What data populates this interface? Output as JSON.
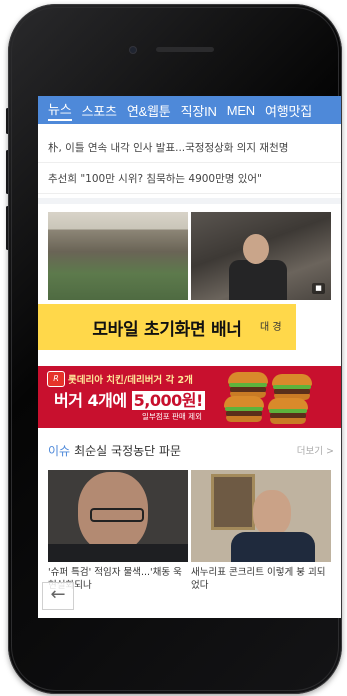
{
  "nav": {
    "tabs": [
      {
        "label": "뉴스",
        "active": true
      },
      {
        "label": "스포츠",
        "active": false
      },
      {
        "label": "연&웹툰",
        "active": false
      },
      {
        "label": "직장IN",
        "active": false
      },
      {
        "label": "MEN",
        "active": false
      },
      {
        "label": "여행맛집",
        "active": false
      }
    ],
    "color": "#4e89d9"
  },
  "headlines": [
    "朴, 이틀 연속 내각 인사 발표...국정정상화 의지 재천명",
    "추선희 \"100만 시위? 침묵하는 4900만명 있어\""
  ],
  "news_cards": {
    "second_caption": "대 경"
  },
  "overlay_banner": {
    "text": "모바일 초기화면 배너",
    "color": "#ffd84a"
  },
  "ad_banner": {
    "logo": "R",
    "top_text": "롯데리아 치킨/데리버거 각 2개",
    "main_prefix": "버거 4개에",
    "main_price": "5,000원!",
    "note": "일부점포 판매 제외",
    "color": "#c8102e"
  },
  "section": {
    "tag": "이슈",
    "title": "최순실 국정농단 파문",
    "more_label": "더보기 >"
  },
  "photo_cards": [
    {
      "caption": "'슈퍼 특검' 적임자 물색...'채동 욱 현실화되나"
    },
    {
      "caption": "새누리표 콘크리트 이렇게 붕 괴되었다"
    }
  ],
  "back_button": {
    "label": "←"
  }
}
